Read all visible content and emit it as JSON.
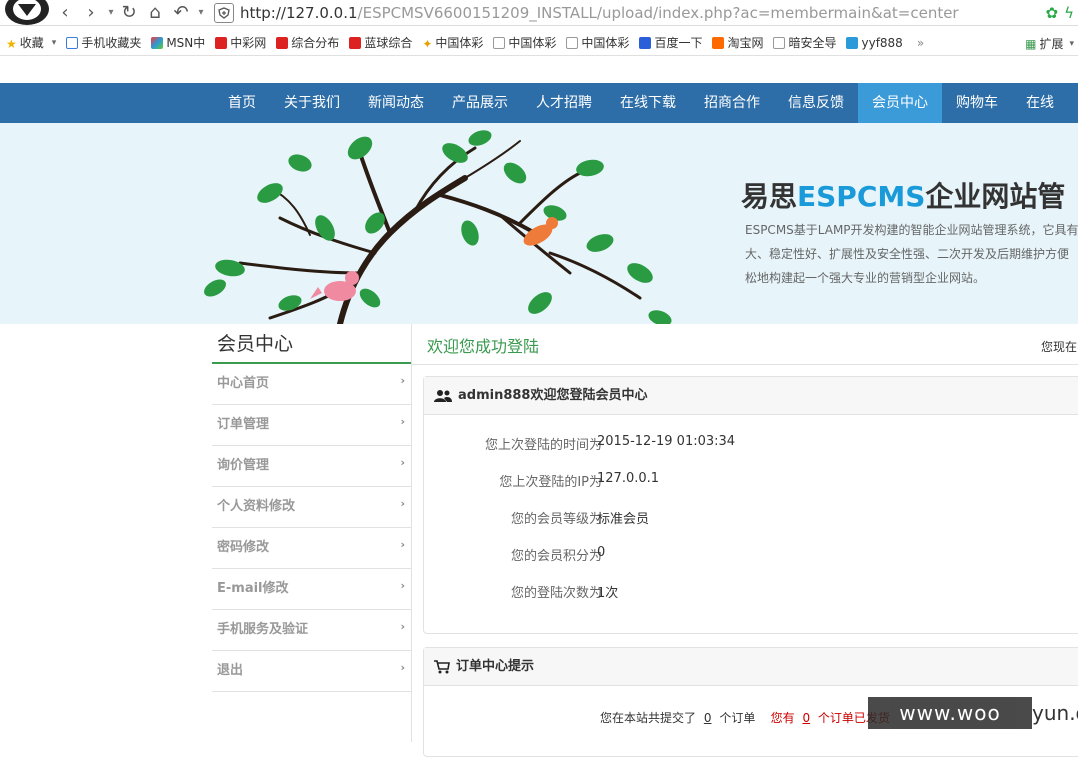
{
  "browser": {
    "url_host": "http://127.0.0.1",
    "url_path": "/ESPCMSV6600151209_INSTALL/upload/index.php?ac=membermain&at=center",
    "bookmarks": [
      {
        "label": "收藏",
        "color": "#f0b400"
      },
      {
        "label": "手机收藏夹",
        "color": "#3b7ddd"
      },
      {
        "label": "MSN中",
        "color": "#2a9ad8"
      },
      {
        "label": "中彩网",
        "color": "#d22"
      },
      {
        "label": "综合分布",
        "color": "#d22"
      },
      {
        "label": "蓝球综合",
        "color": "#d22"
      },
      {
        "label": "中国体彩",
        "color": "#e8a000"
      },
      {
        "label": "中国体彩",
        "color": "#999"
      },
      {
        "label": "中国体彩",
        "color": "#999"
      },
      {
        "label": "百度一下",
        "color": "#2b5fd9"
      },
      {
        "label": "淘宝网",
        "color": "#ff6a00"
      },
      {
        "label": "暗安全导",
        "color": "#999"
      },
      {
        "label": "yyf888",
        "color": "#2a9ad8"
      }
    ],
    "more": "»",
    "extensions_label": "扩展"
  },
  "nav": {
    "items": [
      "首页",
      "关于我们",
      "新闻动态",
      "产品展示",
      "人才招聘",
      "在线下载",
      "招商合作",
      "信息反馈",
      "会员中心",
      "购物车",
      "在线"
    ],
    "active_index": 8
  },
  "banner": {
    "title_prefix": "易思",
    "title_highlight": "ESPCMS",
    "title_suffix": "企业网站管",
    "desc": [
      "ESPCMS基于LAMP开发构建的智能企业网站管理系统，它具有",
      "大、稳定性好、扩展性及安全性强、二次开发及后期维护方便",
      "松地构建起一个强大专业的营销型企业网站。"
    ]
  },
  "sidebar": {
    "title": "会员中心",
    "items": [
      "中心首页",
      "订单管理",
      "询价管理",
      "个人资料修改",
      "密码修改",
      "E-mail修改",
      "手机服务及验证",
      "退出"
    ]
  },
  "main": {
    "title": "欢迎您成功登陆",
    "position_text": "您现在",
    "welcome_panel": {
      "heading": "admin888欢迎您登陆会员中心",
      "rows": [
        {
          "label": "您上次登陆的时间为",
          "value": "2015-12-19 01:03:34"
        },
        {
          "label": "您上次登陆的IP为",
          "value": "127.0.0.1"
        },
        {
          "label": "您的会员等级为",
          "value": "标准会员"
        },
        {
          "label": "您的会员积分为",
          "value": "0"
        },
        {
          "label": "您的登陆次数为",
          "value": "1次"
        }
      ]
    },
    "order_panel": {
      "heading": "订单中心提示",
      "text1": "您在本站共提交了",
      "count1": "0",
      "text2": "个订单",
      "text3": "您有",
      "count2": "0",
      "text4": "个订单已发货"
    }
  },
  "watermark": {
    "text": "www.woo",
    "tail": "yun.org"
  }
}
